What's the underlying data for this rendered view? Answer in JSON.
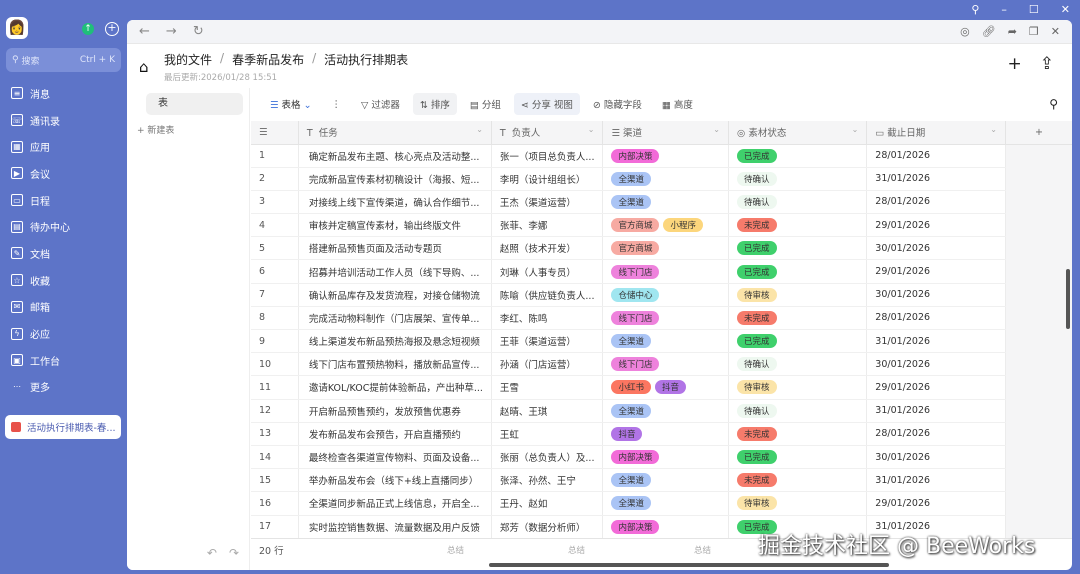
{
  "sidebar": {
    "search_placeholder": "搜索",
    "search_shortcut": "Ctrl + K",
    "items": [
      {
        "label": "消息",
        "icon": "message-icon"
      },
      {
        "label": "通讯录",
        "icon": "contacts-icon"
      },
      {
        "label": "应用",
        "icon": "apps-icon"
      },
      {
        "label": "会议",
        "icon": "meeting-icon"
      },
      {
        "label": "日程",
        "icon": "calendar-icon"
      },
      {
        "label": "待办中心",
        "icon": "todo-icon"
      },
      {
        "label": "文档",
        "icon": "document-icon"
      },
      {
        "label": "收藏",
        "icon": "favorites-icon"
      },
      {
        "label": "邮箱",
        "icon": "mail-icon"
      },
      {
        "label": "必应",
        "icon": "bing-icon"
      },
      {
        "label": "工作台",
        "icon": "workbench-icon"
      },
      {
        "label": "更多",
        "icon": "more-icon"
      }
    ],
    "open_doc": "活动执行排期表-春..."
  },
  "header": {
    "breadcrumb": [
      "我的文件",
      "春季新品发布",
      "活动执行排期表"
    ],
    "last_updated": "最后更新:2026/01/28 15:51"
  },
  "left_panel": {
    "table_tab": "表",
    "new_table": "+ 新建表"
  },
  "toolbar": {
    "view": "表格",
    "filter": "过滤器",
    "sort": "排序",
    "group": "分组",
    "share": "分享 视图",
    "hide": "隐藏字段",
    "height": "高度"
  },
  "columns": [
    "任务",
    "负责人",
    "渠道",
    "素材状态",
    "截止日期"
  ],
  "tag_colors": {
    "内部决策": "#f26bd8",
    "全渠道": "#aac4f5",
    "官方商城": "#f7aaa2",
    "小程序": "#fcd67c",
    "线下门店": "#ee82dc",
    "仓储中心": "#a0e6f0",
    "小红书": "#fb7661",
    "抖音": "#b174e6"
  },
  "status_colors": {
    "已完成": "#3fd06c",
    "待确认": "#eef8f0",
    "未完成": "#f67b6b",
    "待审核": "#fbe4a8"
  },
  "rows": [
    [
      "1",
      "确定新品发布主题、核心亮点及活动整...",
      "张一（项目总负责人...",
      [
        "内部决策"
      ],
      "已完成",
      "28/01/2026"
    ],
    [
      "2",
      "完成新品宣传素材初稿设计（海报、短...",
      "李明（设计组组长）",
      [
        "全渠道"
      ],
      "待确认",
      "31/01/2026"
    ],
    [
      "3",
      "对接线上线下宣传渠道，确认合作细节...",
      "王杰（渠道运营）",
      [
        "全渠道"
      ],
      "待确认",
      "28/01/2026"
    ],
    [
      "4",
      "审核并定稿宣传素材，输出终版文件",
      "张菲、李娜",
      [
        "官方商城",
        "小程序"
      ],
      "未完成",
      "29/01/2026"
    ],
    [
      "5",
      "搭建新品预售页面及活动专题页",
      "赵照（技术开发）",
      [
        "官方商城"
      ],
      "已完成",
      "30/01/2026"
    ],
    [
      "6",
      "招募并培训活动工作人员（线下导购、...",
      "刘琳（人事专员）",
      [
        "线下门店"
      ],
      "已完成",
      "29/01/2026"
    ],
    [
      "7",
      "确认新品库存及发货流程，对接仓储物流",
      "陈喻（供应链负责人...",
      [
        "仓储中心"
      ],
      "待审核",
      "30/01/2026"
    ],
    [
      "8",
      "完成活动物料制作（门店展架、宣传单...",
      "李红、陈鸣",
      [
        "线下门店"
      ],
      "未完成",
      "28/01/2026"
    ],
    [
      "9",
      "线上渠道发布新品预热海报及悬念短视频",
      "王菲（渠道运营）",
      [
        "全渠道"
      ],
      "已完成",
      "31/01/2026"
    ],
    [
      "10",
      "线下门店布置预热物料，播放新品宣传...",
      "孙涵（门店运营）",
      [
        "线下门店"
      ],
      "待确认",
      "30/01/2026"
    ],
    [
      "11",
      "邀请KOL/KOC提前体验新品，产出种草...",
      "王雪",
      [
        "小红书",
        "抖音"
      ],
      "待审核",
      "29/01/2026"
    ],
    [
      "12",
      "开启新品预售预约，发放预售优惠券",
      "赵晴、王琪",
      [
        "全渠道"
      ],
      "待确认",
      "31/01/2026"
    ],
    [
      "13",
      "发布新品发布会预告，开启直播预约",
      "王虹",
      [
        "抖音"
      ],
      "未完成",
      "28/01/2026"
    ],
    [
      "14",
      "最终检查各渠道宣传物料、页面及设备...",
      "张丽（总负责人）及...",
      [
        "内部决策"
      ],
      "已完成",
      "30/01/2026"
    ],
    [
      "15",
      "举办新品发布会（线下+线上直播同步）",
      "张泽、孙然、王宁",
      [
        "全渠道"
      ],
      "未完成",
      "31/01/2026"
    ],
    [
      "16",
      "全渠道同步新品正式上线信息，开启全...",
      "王丹、赵如",
      [
        "全渠道"
      ],
      "待审核",
      "29/01/2026"
    ],
    [
      "17",
      "实时监控销售数据、流量数据及用户反馈",
      "郑芳（数据分析师）",
      [
        "内部决策"
      ],
      "已完成",
      "31/01/2026"
    ]
  ],
  "footer": {
    "row_count": "20 行",
    "summary": "总结"
  },
  "watermark": "掘金技术社区 @ BeeWorks"
}
